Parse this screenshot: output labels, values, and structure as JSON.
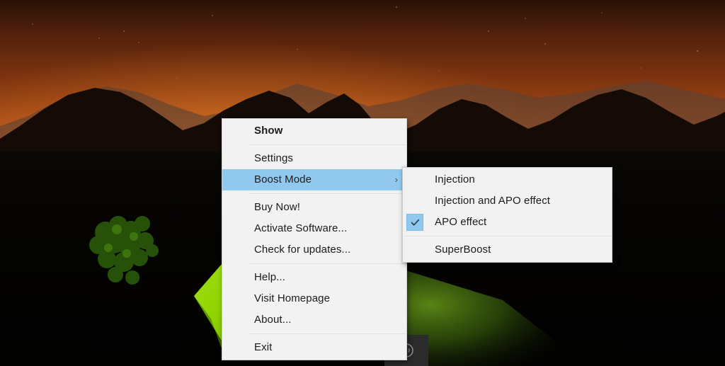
{
  "wallpaper": {
    "description": "night-sky-mountains-camping-tent",
    "sky_color": "#c2641f",
    "tent_color": "#8fd400",
    "ground_color": "#050403"
  },
  "tray": {
    "chip_color": "#2b2b2b",
    "icon_name": "volume-circle-icon"
  },
  "colors": {
    "menu_background": "#f2f2f2",
    "menu_border": "#cfcfcf",
    "highlight": "#91c9ee",
    "separator": "#e0e0e0",
    "text": "#1b1b1b"
  },
  "main_menu": {
    "groups": [
      {
        "items": [
          {
            "label": "Show",
            "bold": true,
            "highlight": false,
            "submenu": false
          }
        ]
      },
      {
        "items": [
          {
            "label": "Settings",
            "bold": false,
            "highlight": false,
            "submenu": false
          },
          {
            "label": "Boost Mode",
            "bold": false,
            "highlight": true,
            "submenu": true,
            "chevron": "›"
          }
        ]
      },
      {
        "items": [
          {
            "label": "Buy Now!",
            "bold": false,
            "highlight": false,
            "submenu": false
          },
          {
            "label": "Activate Software...",
            "bold": false,
            "highlight": false,
            "submenu": false
          },
          {
            "label": "Check for updates...",
            "bold": false,
            "highlight": false,
            "submenu": false
          }
        ]
      },
      {
        "items": [
          {
            "label": "Help...",
            "bold": false,
            "highlight": false,
            "submenu": false
          },
          {
            "label": "Visit Homepage",
            "bold": false,
            "highlight": false,
            "submenu": false
          },
          {
            "label": "About...",
            "bold": false,
            "highlight": false,
            "submenu": false
          }
        ]
      },
      {
        "items": [
          {
            "label": "Exit",
            "bold": false,
            "highlight": false,
            "submenu": false
          }
        ]
      }
    ],
    "items_flat": {
      "show": "Show",
      "settings": "Settings",
      "boost_mode": "Boost Mode",
      "boost_mode_chevron": "›",
      "buy_now": "Buy Now!",
      "activate_software": "Activate Software...",
      "check_for_updates": "Check for updates...",
      "help": "Help...",
      "visit_homepage": "Visit Homepage",
      "about": "About...",
      "exit": "Exit"
    }
  },
  "sub_menu": {
    "title": "Boost Mode",
    "items": {
      "injection": "Injection",
      "injection_and_apo": "Injection and APO effect",
      "apo_effect": "APO effect",
      "superboost": "SuperBoost"
    },
    "checked_item": "APO effect",
    "check_glyph": "check-icon"
  }
}
